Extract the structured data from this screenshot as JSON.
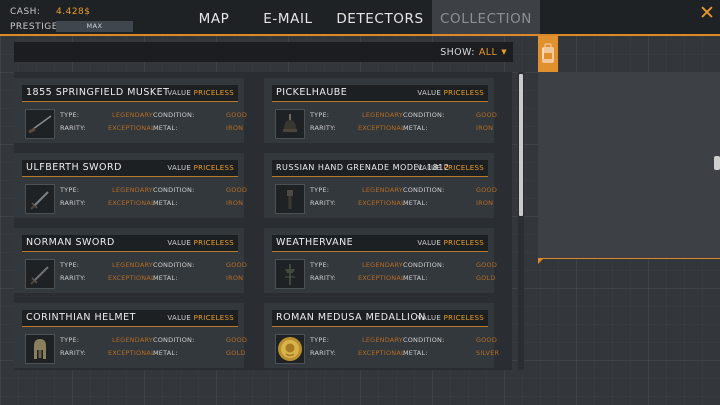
{
  "stats": {
    "cash_label": "CASH:",
    "cash_value": "4.428$",
    "prestige_label": "PRESTIGE:",
    "prestige_value": "MAX"
  },
  "tabs": [
    {
      "label": "MAP"
    },
    {
      "label": "E-MAIL"
    },
    {
      "label": "DETECTORS"
    },
    {
      "label": "COLLECTION",
      "active": true
    }
  ],
  "filter": {
    "label": "SHOW:",
    "value": "ALL"
  },
  "icons": {
    "close": "close-icon",
    "bag": "backpack-icon",
    "caret": "caret-down-icon"
  },
  "colors": {
    "accent": "#e89a2c",
    "rarity": "#b46b24"
  },
  "labels": {
    "value": "VALUE",
    "type": "TYPE:",
    "rarity": "RARITY:",
    "condition": "CONDITION:",
    "metal": "METAL:"
  },
  "items": [
    {
      "name": "1855 SPRINGFIELD MUSKET",
      "value": "PRICELESS",
      "type": "LEGENDARY",
      "rarity": "EXCEPTIONAL",
      "condition": "GOOD",
      "metal": "IRON",
      "icon": "musket-icon"
    },
    {
      "name": "PICKELHAUBE",
      "value": "PRICELESS",
      "type": "LEGENDARY",
      "rarity": "EXCEPTIONAL",
      "condition": "GOOD",
      "metal": "IRON",
      "icon": "spiked-helmet-icon"
    },
    {
      "name": "ULFBERTH SWORD",
      "value": "PRICELESS",
      "type": "LEGENDARY",
      "rarity": "EXCEPTIONAL",
      "condition": "GOOD",
      "metal": "IRON",
      "icon": "sword-icon"
    },
    {
      "name": "RUSSIAN HAND GRENADE MODEL 1812",
      "value": "PRICELESS",
      "type": "LEGENDARY",
      "rarity": "EXCEPTIONAL",
      "condition": "GOOD",
      "metal": "IRON",
      "icon": "grenade-icon"
    },
    {
      "name": "NORMAN SWORD",
      "value": "PRICELESS",
      "type": "LEGENDARY",
      "rarity": "EXCEPTIONAL",
      "condition": "GOOD",
      "metal": "IRON",
      "icon": "sword-icon"
    },
    {
      "name": "WEATHERVANE",
      "value": "PRICELESS",
      "type": "LEGENDARY",
      "rarity": "EXCEPTIONAL",
      "condition": "GOOD",
      "metal": "GOLD",
      "icon": "weathervane-icon"
    },
    {
      "name": "CORINTHIAN HELMET",
      "value": "PRICELESS",
      "type": "LEGENDARY",
      "rarity": "EXCEPTIONAL",
      "condition": "GOOD",
      "metal": "GOLD",
      "icon": "greek-helmet-icon"
    },
    {
      "name": "ROMAN MEDUSA MEDALLION",
      "value": "PRICELESS",
      "type": "LEGENDARY",
      "rarity": "EXCEPTIONAL",
      "condition": "GOOD",
      "metal": "SILVER",
      "icon": "medallion-icon"
    }
  ]
}
